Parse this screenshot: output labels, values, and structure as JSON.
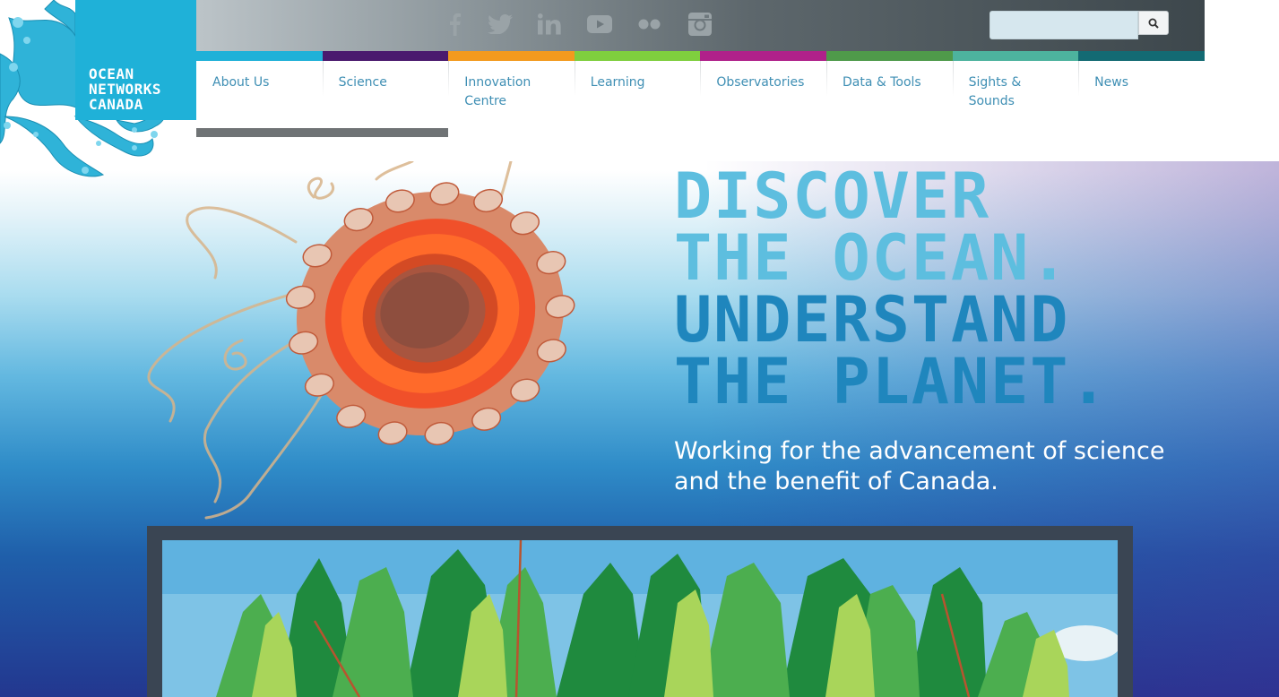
{
  "logo": {
    "line1": "OCEAN",
    "line2": "NETWORKS",
    "line3": "CANADA"
  },
  "social": [
    {
      "name": "facebook-icon"
    },
    {
      "name": "twitter-icon"
    },
    {
      "name": "linkedin-icon"
    },
    {
      "name": "youtube-icon"
    },
    {
      "name": "flickr-icon"
    },
    {
      "name": "instagram-icon"
    }
  ],
  "search": {
    "placeholder": "",
    "value": ""
  },
  "nav": [
    {
      "label": "About Us",
      "color": "#1fb1d8"
    },
    {
      "label": "Science",
      "color": "#4a1a6e"
    },
    {
      "label": "Innovation Centre",
      "color": "#f39a1e"
    },
    {
      "label": "Learning",
      "color": "#7fcf3e"
    },
    {
      "label": "Observatories",
      "color": "#b0218a"
    },
    {
      "label": "Data & Tools",
      "color": "#4f9a4a"
    },
    {
      "label": "Sights & Sounds",
      "color": "#4db39e"
    },
    {
      "label": "News",
      "color": "#136a73"
    }
  ],
  "hero": {
    "line1": "DISCOVER",
    "line2": "THE OCEAN.",
    "line3": "UNDERSTAND",
    "line4": "THE PLANET.",
    "tagline": "Working for the advancement of science and the benefit of Canada."
  },
  "colors": {
    "brand": "#1fb1d8",
    "headline_light": "#5dbedf",
    "headline_dark": "#1f86bd"
  }
}
